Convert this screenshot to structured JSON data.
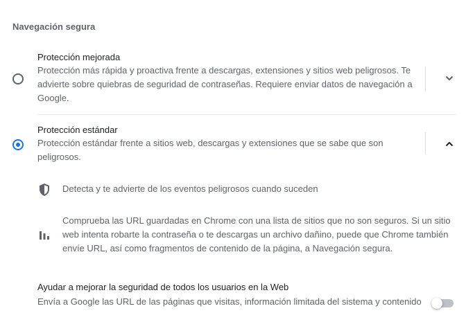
{
  "section": {
    "title": "Navegación segura"
  },
  "enhanced": {
    "label": "Protección mejorada",
    "desc_lines": [
      "Protección más rápida y proactiva frente a descargas, extensiones y sitios web peligrosos. Te",
      "advierte sobre quiebras de seguridad de contraseñas. Requiere enviar datos de navegación a",
      "Google."
    ],
    "selected": false,
    "expanded": false,
    "expand_icon": "chevron-down-icon"
  },
  "standard": {
    "label": "Protección estándar",
    "desc_lines": [
      "Protección estándar frente a sitios web, descargas y extensiones que se sabe que son",
      "peligrosos."
    ],
    "selected": true,
    "expanded": true,
    "collapse_icon": "chevron-up-icon",
    "features": [
      {
        "icon": "shield-icon",
        "lines": [
          "Detecta y te advierte de los eventos peligrosos cuando suceden"
        ]
      },
      {
        "icon": "bar-chart-icon",
        "lines": [
          "Comprueba las URL guardadas en Chrome con una lista de sitios que no son seguros. Si un sitio",
          "web intenta robarte la contraseña o te descargas un archivo dañino, puede que Chrome también",
          "envíe URL, así como fragmentos de contenido de la página, a Navegación segura."
        ]
      }
    ]
  },
  "improve": {
    "label": "Ayudar a mejorar la seguridad de todos los usuarios en la Web",
    "desc_line": "Envía a Google las URL de las páginas que visitas, información limitada del sistema y contenido",
    "toggle_on": false
  },
  "colors": {
    "accent": "#1a73e8",
    "secondary_text": "#5f6368",
    "primary_text": "#202124",
    "divider": "#dadce0"
  }
}
